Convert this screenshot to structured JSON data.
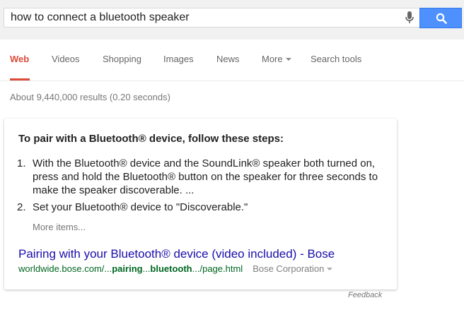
{
  "search": {
    "query": "how to connect a bluetooth speaker"
  },
  "tabs": [
    {
      "label": "Web",
      "active": true
    },
    {
      "label": "Videos"
    },
    {
      "label": "Shopping"
    },
    {
      "label": "Images"
    },
    {
      "label": "News"
    },
    {
      "label": "More"
    },
    {
      "label": "Search tools"
    }
  ],
  "stats": "About 9,440,000 results (0.20 seconds)",
  "answer": {
    "title": "To pair with a Bluetooth® device, follow these steps:",
    "steps": [
      {
        "num": "1.",
        "text": "With the Bluetooth® device and the SoundLink® speaker both turned on, press and hold the Bluetooth® button on the speaker for three seconds to make the speaker discoverable. ..."
      },
      {
        "num": "2.",
        "text": "Set your Bluetooth® device to \"Discoverable.\""
      }
    ],
    "more_items": "More items...",
    "link_title": "Pairing with your Bluetooth® device (video included) - Bose",
    "url": {
      "part1": "worldwide.bose.com/...",
      "bold1": "pairing",
      "part2": "...",
      "bold2": "bluetooth",
      "part3": ".../page.html"
    },
    "source": "Bose Corporation"
  },
  "feedback": "Feedback",
  "colors": {
    "accent": "#dd4b39",
    "search_button": "#4d90fe",
    "link": "#1a0dab",
    "url": "#006621"
  },
  "icons": {
    "mic": "microphone-icon",
    "search": "magnifier-icon"
  }
}
